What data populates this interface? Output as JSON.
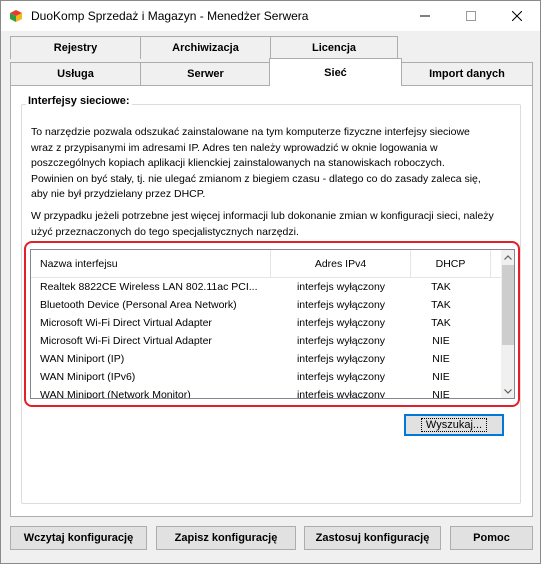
{
  "window": {
    "title": "DuoKomp Sprzedaż i Magazyn - Menedżer Serwera"
  },
  "tabs": {
    "row1": [
      "Rejestry",
      "Archiwizacja",
      "Licencja"
    ],
    "row2": [
      "Usługa",
      "Serwer",
      "Sieć",
      "Import danych"
    ],
    "active": "Sieć"
  },
  "network": {
    "group_title": "Interfejsy sieciowe:",
    "description_lines": [
      "To narzędzie pozwala odszukać zainstalowane na tym komputerze fizyczne interfejsy sieciowe",
      "wraz z przypisanymi im adresami IP. Adres ten należy wprowadzić w oknie logowania w",
      "poszczególnych kopiach aplikacji klienckiej zainstalowanych na stanowiskach roboczych.",
      "Powinien on być stały, tj. nie ulegać zmianom z biegiem czasu - dlatego co do zasady zaleca się,",
      "aby nie był przydzielany przez DHCP."
    ],
    "description2_lines": [
      "W przypadku jeżeli potrzebne jest więcej informacji lub dokonanie zmian w konfiguracji sieci, należy",
      "użyć przeznaczonych do tego specjalistycznych narzędzi."
    ],
    "columns": [
      "Nazwa interfejsu",
      "Adres IPv4",
      "DHCP"
    ],
    "rows": [
      [
        "Realtek 8822CE Wireless LAN 802.11ac PCI...",
        "interfejs wyłączony",
        "TAK"
      ],
      [
        "Bluetooth Device (Personal Area Network)",
        "interfejs wyłączony",
        "TAK"
      ],
      [
        "Microsoft Wi-Fi Direct Virtual Adapter",
        "interfejs wyłączony",
        "TAK"
      ],
      [
        "Microsoft Wi-Fi Direct Virtual Adapter",
        "interfejs wyłączony",
        "NIE"
      ],
      [
        "WAN Miniport (IP)",
        "interfejs wyłączony",
        "NIE"
      ],
      [
        "WAN Miniport (IPv6)",
        "interfejs wyłączony",
        "NIE"
      ],
      [
        "WAN Miniport (Network Monitor)",
        "interfejs wyłączony",
        "NIE"
      ]
    ],
    "search_button": "Wyszukaj..."
  },
  "footer": {
    "load": "Wczytaj konfigurację",
    "save": "Zapisz konfigurację",
    "apply": "Zastosuj konfigurację",
    "help": "Pomoc"
  },
  "colors": {
    "highlight": "#e0202b",
    "default_button_border": "#0078d7"
  }
}
